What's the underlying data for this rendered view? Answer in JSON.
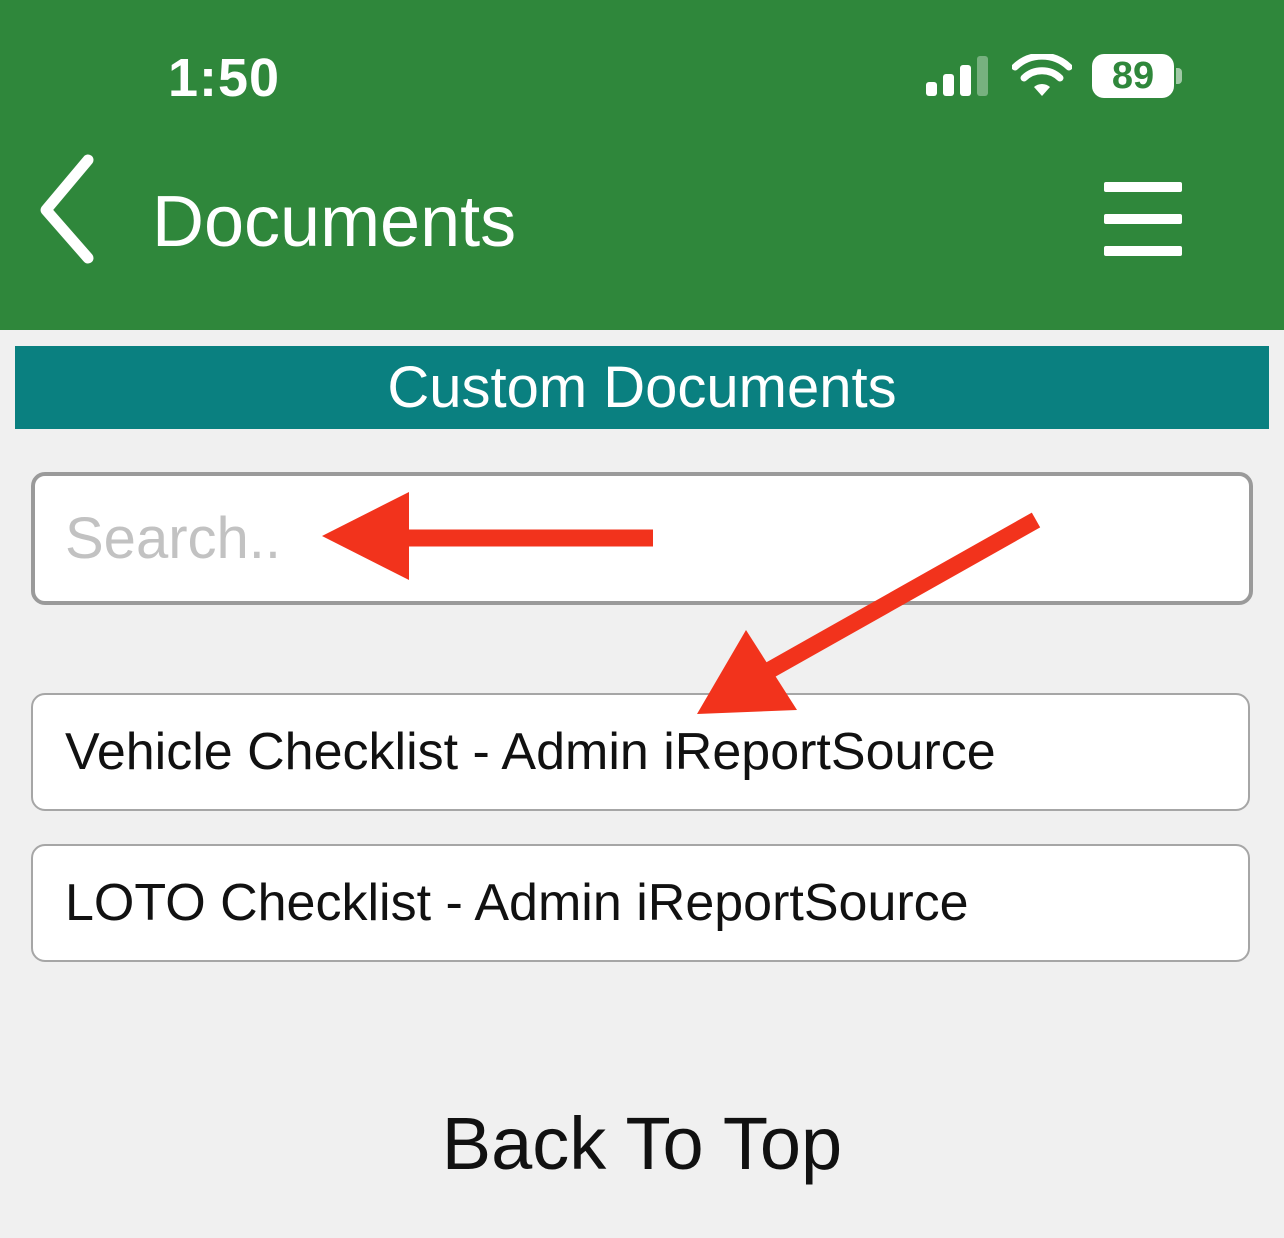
{
  "status_bar": {
    "time": "1:50",
    "battery_level": "89",
    "icons": [
      "signal-icon",
      "wifi-icon",
      "battery-icon"
    ]
  },
  "nav_bar": {
    "title": "Documents",
    "back_icon": "chevron-left-icon",
    "menu_icon": "hamburger-menu-icon"
  },
  "section": {
    "title": "Custom Documents"
  },
  "search": {
    "placeholder": "Search..",
    "value": ""
  },
  "documents": [
    {
      "label": "Vehicle Checklist - Admin iReportSource"
    },
    {
      "label": "LOTO Checklist - Admin iReportSource"
    }
  ],
  "footer": {
    "back_to_top": "Back To Top"
  },
  "colors": {
    "header": "#2f873b",
    "banner": "#0a8080",
    "background": "#f0f0f0",
    "annotation_arrow": "#f2331c"
  }
}
